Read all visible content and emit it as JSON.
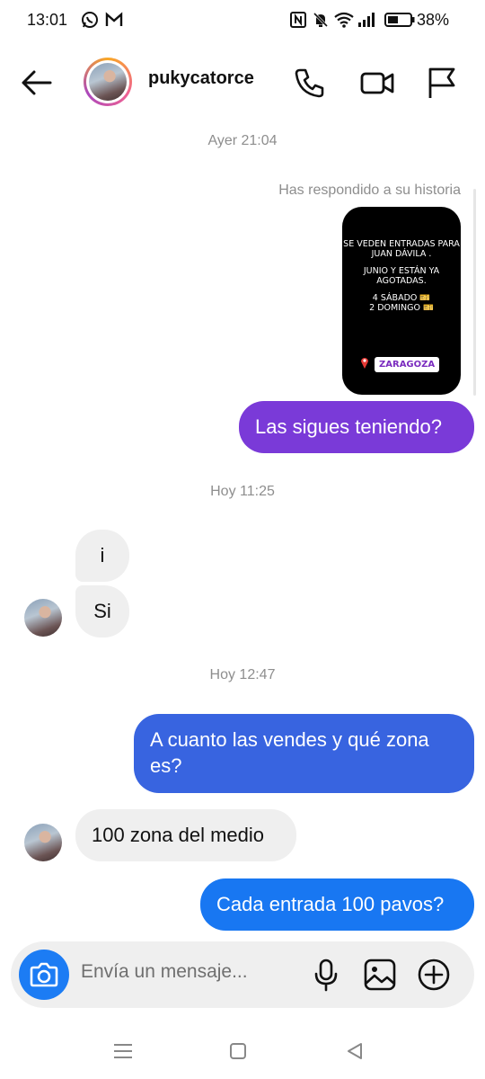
{
  "status_bar": {
    "time": "13:01",
    "battery": "38%",
    "icons": [
      "whatsapp-icon",
      "gmail-icon",
      "nfc-icon",
      "bell-muted-icon",
      "wifi-icon",
      "signal-icon",
      "battery-icon"
    ]
  },
  "header": {
    "username": "pukycatorce",
    "icons": [
      "back-arrow-icon",
      "phone-icon",
      "video-camera-icon",
      "flag-icon"
    ]
  },
  "messages": {
    "ts1": "Ayer 21:04",
    "reply_note": "Has respondido a su historia",
    "story": {
      "line1": "SE VEDEN ENTRADAS PARA JUAN DÁVILA .",
      "line2": "JUNIO Y ESTÁN YA AGOTADAS.",
      "line3": "4 SÁBADO 🎫",
      "line4": "2 DOMINGO 🎫",
      "location": "ZARAGOZA"
    },
    "m1": "Las sigues teniendo?",
    "ts2": "Hoy 11:25",
    "m2": "i",
    "m3": "Si",
    "ts3": "Hoy 12:47",
    "m4": "A cuanto las vendes y qué zona es?",
    "m5": "100 zona del medio",
    "m6": "Cada entrada 100 pavos?"
  },
  "composer": {
    "placeholder": "Envía un mensaje...",
    "icons": [
      "camera-icon",
      "microphone-icon",
      "gallery-icon",
      "add-icon"
    ]
  },
  "colors": {
    "purple_bubble": "#7a3ad8",
    "blue_bubble_1": "#3864e0",
    "blue_bubble_2": "#1877f2",
    "incoming_bubble": "#efefef",
    "camera_button": "#1c7cf4"
  }
}
